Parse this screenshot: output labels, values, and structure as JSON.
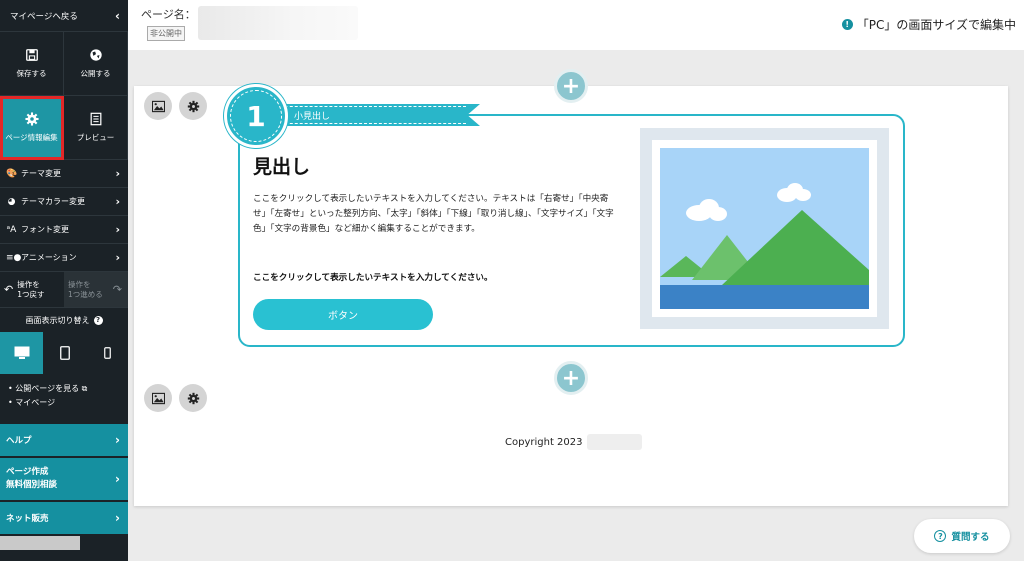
{
  "sidebar": {
    "back_label": "マイページへ戻る",
    "save_label": "保存する",
    "publish_label": "公開する",
    "page_info_label": "ページ情報編集",
    "preview_label": "プレビュー",
    "menu": [
      {
        "label": "テーマ変更",
        "icon": "palette-icon"
      },
      {
        "label": "テーマカラー変更",
        "icon": "color-palette-icon"
      },
      {
        "label": "フォント変更",
        "icon": "font-icon"
      },
      {
        "label": "アニメーション",
        "icon": "animation-icon"
      }
    ],
    "undo_label": "操作を\n1つ戻す",
    "redo_label": "操作を\n1つ進める",
    "view_switch_label": "画面表示切り替え",
    "links": [
      "公開ページを見る",
      "マイページ"
    ],
    "help_label": "ヘルプ",
    "consult_label_1": "ページ作成",
    "consult_label_2": "無料個別相談",
    "net_sales_label": "ネット販売"
  },
  "topbar": {
    "page_name_label": "ページ名：",
    "private_badge": "非公開中",
    "edit_note": "「PC」の画面サイズで編集中"
  },
  "section": {
    "number": "1",
    "subheading": "小見出し",
    "heading": "見出し",
    "body": "ここをクリックして表示したいテキストを入力してください。テキストは「右寄せ」「中央寄せ」「左寄せ」といった整列方向、「太字」「斜体」「下線」「取り消し線」、「文字サイズ」「文字色」「文字の背景色」など細かく編集することができます。",
    "bold_text": "ここをクリックして表示したいテキストを入力してください。",
    "button_label": "ボタン"
  },
  "footer": {
    "copyright": "Copyright 2023"
  },
  "help_button_label": "質問する",
  "colors": {
    "accent": "#29b6c9",
    "sidebar_bg": "#1b2227",
    "highlight": "#e32727"
  }
}
